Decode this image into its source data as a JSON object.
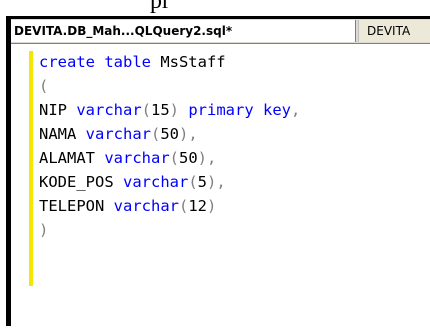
{
  "background_fragment": "pr",
  "tabs": [
    {
      "label": "DEVITA.DB_Mah...QLQuery2.sql*",
      "active": true
    },
    {
      "label": "DEVITA",
      "active": false
    }
  ],
  "editor": {
    "lines": [
      [
        {
          "t": "create table",
          "c": "kw"
        },
        {
          "t": " MsStaff",
          "c": "id"
        }
      ],
      [
        {
          "t": "(",
          "c": "gr"
        }
      ],
      [
        {
          "t": "NIP ",
          "c": "id"
        },
        {
          "t": "varchar",
          "c": "kw"
        },
        {
          "t": "(",
          "c": "gr"
        },
        {
          "t": "15",
          "c": "id"
        },
        {
          "t": ")",
          "c": "gr"
        },
        {
          "t": " primary key",
          "c": "kw"
        },
        {
          "t": ",",
          "c": "gr"
        }
      ],
      [
        {
          "t": "NAMA ",
          "c": "id"
        },
        {
          "t": "varchar",
          "c": "kw"
        },
        {
          "t": "(",
          "c": "gr"
        },
        {
          "t": "50",
          "c": "id"
        },
        {
          "t": ")",
          "c": "gr"
        },
        {
          "t": ",",
          "c": "gr"
        }
      ],
      [
        {
          "t": "ALAMAT ",
          "c": "id"
        },
        {
          "t": "varchar",
          "c": "kw"
        },
        {
          "t": "(",
          "c": "gr"
        },
        {
          "t": "50",
          "c": "id"
        },
        {
          "t": ")",
          "c": "gr"
        },
        {
          "t": ",",
          "c": "gr"
        }
      ],
      [
        {
          "t": "KODE_POS ",
          "c": "id"
        },
        {
          "t": "varchar",
          "c": "kw"
        },
        {
          "t": "(",
          "c": "gr"
        },
        {
          "t": "5",
          "c": "id"
        },
        {
          "t": ")",
          "c": "gr"
        },
        {
          "t": ",",
          "c": "gr"
        }
      ],
      [
        {
          "t": "TELEPON ",
          "c": "id"
        },
        {
          "t": "varchar",
          "c": "kw"
        },
        {
          "t": "(",
          "c": "gr"
        },
        {
          "t": "12",
          "c": "id"
        },
        {
          "t": ")",
          "c": "gr"
        }
      ],
      [
        {
          "t": ")",
          "c": "gr"
        }
      ]
    ]
  },
  "colors": {
    "keyword": "#0000ff",
    "identifier": "#000000",
    "operator": "#808080",
    "change_margin": "#f5e600"
  }
}
